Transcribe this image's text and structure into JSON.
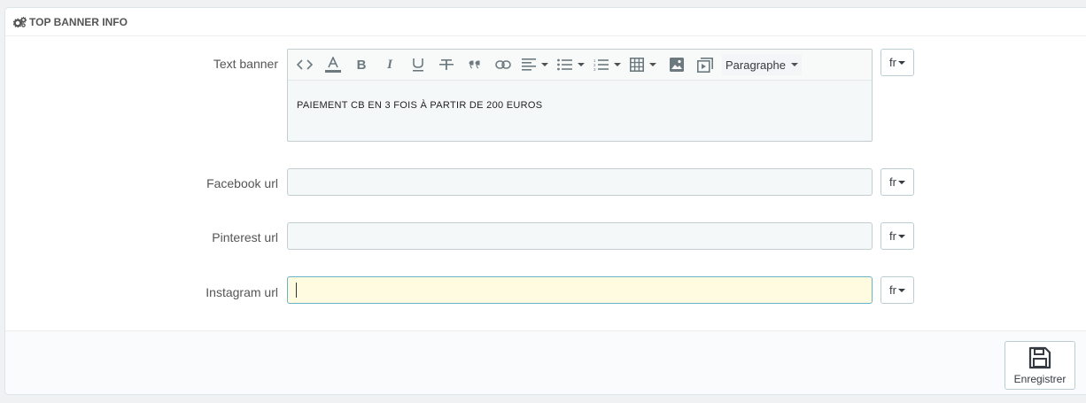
{
  "panel": {
    "title": "TOP BANNER INFO",
    "title_icon": "cogs-icon"
  },
  "form": {
    "text_banner": {
      "label": "Text banner",
      "content": "PAIEMENT CB EN 3 FOIS À PARTIR DE 200 EUROS",
      "lang": "fr",
      "toolbar": [
        "code-icon",
        "font-color-icon",
        "bold-icon",
        "italic-icon",
        "underline-icon",
        "strikethrough-icon",
        "blockquote-icon",
        "link-icon",
        "align-left-icon",
        "bullet-list-icon",
        "numbered-list-icon",
        "table-icon",
        "image-icon",
        "media-icon"
      ],
      "format_select": "Paragraphe"
    },
    "facebook": {
      "label": "Facebook url",
      "value": "",
      "lang": "fr"
    },
    "pinterest": {
      "label": "Pinterest url",
      "value": "",
      "lang": "fr"
    },
    "instagram": {
      "label": "Instagram url",
      "value": "",
      "lang": "fr"
    }
  },
  "footer": {
    "save_label": "Enregistrer",
    "save_icon": "floppy-disk-icon"
  },
  "colors": {
    "focused_bg": "#fffbe1",
    "input_bg": "#f5f8f9",
    "border": "#c4cdd0"
  }
}
